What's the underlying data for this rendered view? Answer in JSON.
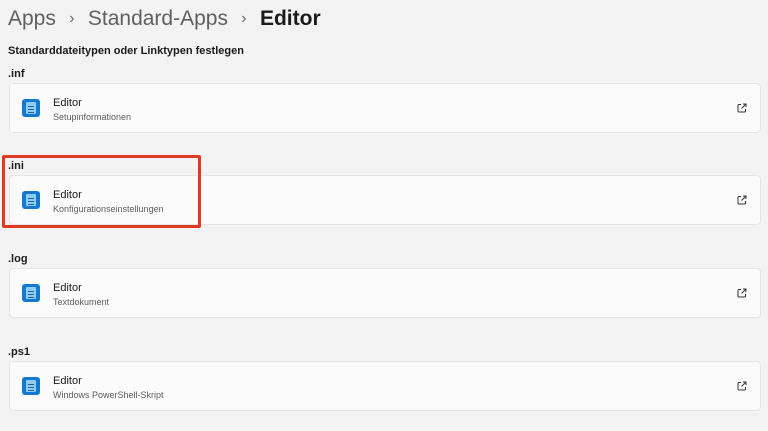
{
  "breadcrumb": [
    {
      "label": "Apps"
    },
    {
      "label": "Standard-Apps"
    },
    {
      "label": "Editor"
    }
  ],
  "section_heading": "Standarddateitypen oder Linktypen festlegen",
  "associations": [
    {
      "extension": ".inf",
      "app": "Editor",
      "description": "Setupinformationen",
      "icon": "notepad-icon"
    },
    {
      "extension": ".ini",
      "app": "Editor",
      "description": "Konfigurationseinstellungen",
      "icon": "notepad-icon"
    },
    {
      "extension": ".log",
      "app": "Editor",
      "description": "Textdokument",
      "icon": "notepad-icon"
    },
    {
      "extension": ".ps1",
      "app": "Editor",
      "description": "Windows PowerShell-Skript",
      "icon": "notepad-icon"
    }
  ],
  "open_icon": "external-link-icon",
  "highlight_color": "#df3b22",
  "accent_color": "#1578d1"
}
